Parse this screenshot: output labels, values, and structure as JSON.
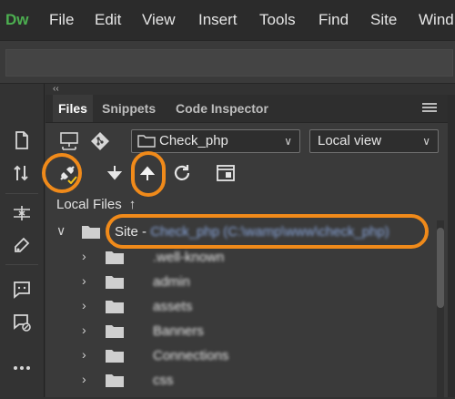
{
  "app": {
    "logo": "Dw"
  },
  "menubar": {
    "items": [
      "File",
      "Edit",
      "View",
      "Insert",
      "Tools",
      "Find",
      "Site",
      "Wind"
    ]
  },
  "panel": {
    "collapse": "‹‹",
    "tabs": [
      "Files",
      "Snippets",
      "Code Inspector"
    ],
    "site_select": "Check_php",
    "view_select": "Local view",
    "local_files_label": "Local Files",
    "local_files_sort_glyph": "↑"
  },
  "tree": {
    "site_prefix": "Site - ",
    "site_name": "Check_php (C:\\wamp\\www\\check_php)",
    "folders": [
      ".well-known",
      "admin",
      "assets",
      "Banners",
      "Connections",
      "css"
    ]
  },
  "colors": {
    "highlight": "#f08a1a",
    "logo": "#4caf50"
  },
  "icons": {
    "left_tools": [
      "document-icon",
      "transfer-icon",
      "expand-icon",
      "code-snippet-icon",
      "comment-icon",
      "comment-edit-icon",
      "more-icon"
    ],
    "row1": [
      "connect-site-icon",
      "git-icon"
    ],
    "row2": [
      "connect-plug-icon",
      "get-down-arrow-icon",
      "put-up-arrow-icon",
      "refresh-icon",
      "expand-panel-icon"
    ]
  }
}
